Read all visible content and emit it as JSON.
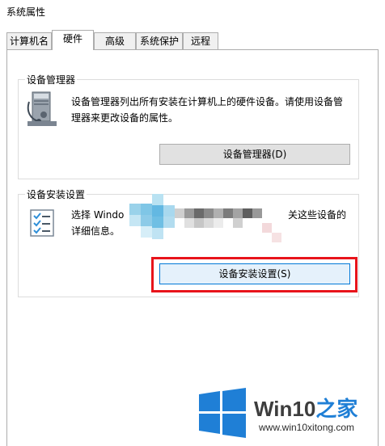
{
  "window": {
    "title": "系统属性"
  },
  "tabs": [
    {
      "label": "计算机名"
    },
    {
      "label": "硬件"
    },
    {
      "label": "高级"
    },
    {
      "label": "系统保护"
    },
    {
      "label": "远程"
    }
  ],
  "active_tab": "硬件",
  "device_manager": {
    "group_title": "设备管理器",
    "description_line1": "设备管理器列出所有安装在计算机上的硬件设备。请使用设备管",
    "description_line2": "理器来更改设备的属性。",
    "button_label": "设备管理器(D)"
  },
  "device_install": {
    "group_title": "设备安装设置",
    "description_line1_start": "选择 Windo",
    "description_line1_end": "关这些设备的",
    "description_line2": "详细信息。",
    "button_label": "设备安装设置(S)"
  },
  "watermark": {
    "brand_prefix": "Win10",
    "brand_suffix": "之家",
    "url": "www.win10xitong.com"
  },
  "colors": {
    "highlight": "#e8141b",
    "win_blue": "#1f7fd6"
  }
}
